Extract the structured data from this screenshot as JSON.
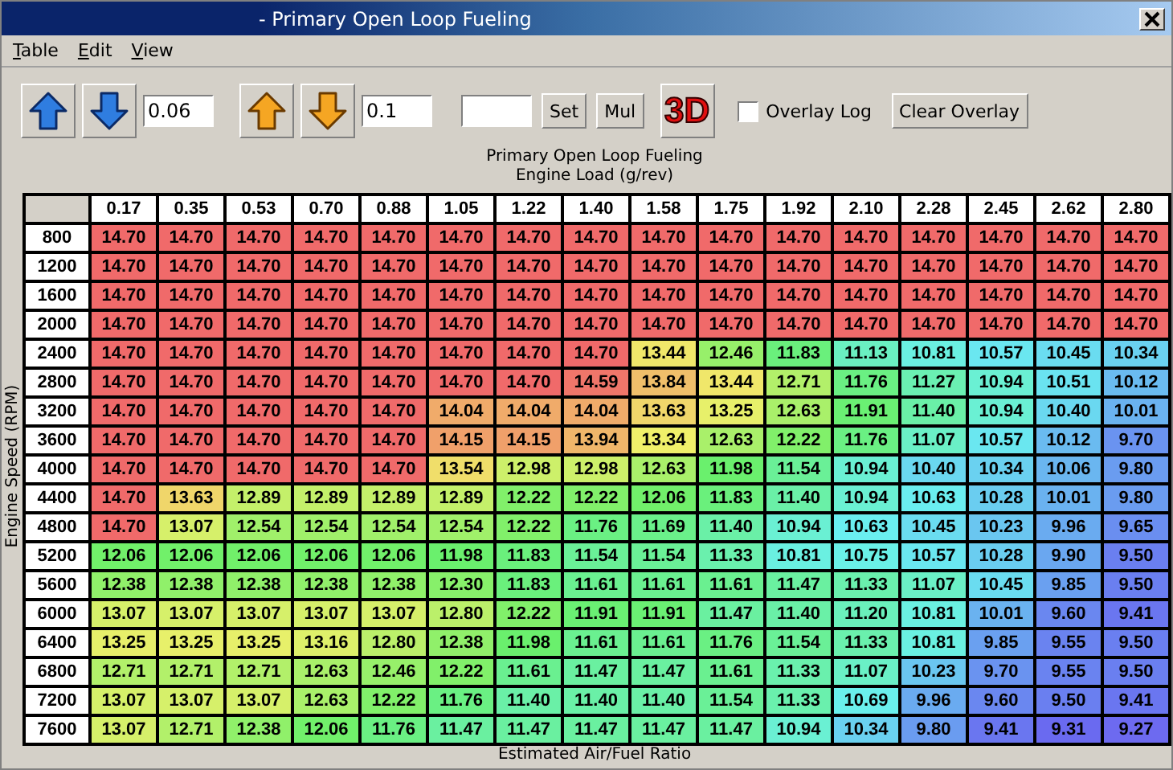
{
  "window": {
    "title": "- Primary Open Loop Fueling"
  },
  "menu": [
    "Table",
    "Edit",
    "View"
  ],
  "toolbar": [
    {
      "kind": "up-small"
    },
    {
      "kind": "down-small"
    },
    {
      "kind": "input",
      "value": "0.06"
    },
    {
      "kind": "up-large"
    },
    {
      "kind": "down-large"
    },
    {
      "kind": "input",
      "value": "0.1"
    },
    {
      "kind": "input"
    },
    {
      "kind": "button",
      "label": "Set"
    },
    {
      "kind": "button",
      "label": "Mul"
    },
    {
      "kind": "logo",
      "label": "3D"
    },
    {
      "kind": "checkbox",
      "label": "Overlay Log",
      "checked": false
    },
    {
      "kind": "button",
      "label": "Clear Overlay"
    }
  ],
  "table": {
    "title": "Primary Open Loop Fueling",
    "x_label": "Engine Load (g/rev)",
    "y_label": "Engine Speed (RPM)",
    "columns": [
      "0.17",
      "0.35",
      "0.53",
      "0.70",
      "0.88",
      "1.05",
      "1.22",
      "1.40",
      "1.58",
      "1.75",
      "1.92",
      "2.10",
      "2.28",
      "2.45",
      "2.62",
      "2.80"
    ],
    "rows": [
      {
        "rpm": "800",
        "values": [
          "14.70",
          "14.70",
          "14.70",
          "14.70",
          "14.70",
          "14.70",
          "14.70",
          "14.70",
          "14.70",
          "14.70",
          "14.70",
          "14.70",
          "14.70",
          "14.70",
          "14.70",
          "14.70"
        ]
      },
      {
        "rpm": "1200",
        "values": [
          "14.70",
          "14.70",
          "14.70",
          "14.70",
          "14.70",
          "14.70",
          "14.70",
          "14.70",
          "14.70",
          "14.70",
          "14.70",
          "14.70",
          "14.70",
          "14.70",
          "14.70",
          "14.70"
        ]
      },
      {
        "rpm": "1600",
        "values": [
          "14.70",
          "14.70",
          "14.70",
          "14.70",
          "14.70",
          "14.70",
          "14.70",
          "14.70",
          "14.70",
          "14.70",
          "14.70",
          "14.70",
          "14.70",
          "14.70",
          "14.70",
          "14.70"
        ]
      },
      {
        "rpm": "2000",
        "values": [
          "14.70",
          "14.70",
          "14.70",
          "14.70",
          "14.70",
          "14.70",
          "14.70",
          "14.70",
          "14.70",
          "14.70",
          "14.70",
          "14.70",
          "14.70",
          "14.70",
          "14.70",
          "14.70"
        ]
      },
      {
        "rpm": "2400",
        "values": [
          "14.70",
          "14.70",
          "14.70",
          "14.70",
          "14.70",
          "14.70",
          "14.70",
          "14.70",
          "13.44",
          "12.46",
          "11.83",
          "11.13",
          "10.81",
          "10.57",
          "10.45",
          "10.34"
        ]
      },
      {
        "rpm": "2800",
        "values": [
          "14.70",
          "14.70",
          "14.70",
          "14.70",
          "14.70",
          "14.70",
          "14.70",
          "14.59",
          "13.84",
          "13.44",
          "12.71",
          "11.76",
          "11.27",
          "10.94",
          "10.51",
          "10.12"
        ]
      },
      {
        "rpm": "3200",
        "values": [
          "14.70",
          "14.70",
          "14.70",
          "14.70",
          "14.70",
          "14.04",
          "14.04",
          "14.04",
          "13.63",
          "13.25",
          "12.63",
          "11.91",
          "11.40",
          "10.94",
          "10.40",
          "10.01"
        ]
      },
      {
        "rpm": "3600",
        "values": [
          "14.70",
          "14.70",
          "14.70",
          "14.70",
          "14.70",
          "14.15",
          "14.15",
          "13.94",
          "13.34",
          "12.63",
          "12.22",
          "11.76",
          "11.07",
          "10.57",
          "10.12",
          "9.70"
        ]
      },
      {
        "rpm": "4000",
        "values": [
          "14.70",
          "14.70",
          "14.70",
          "14.70",
          "14.70",
          "13.54",
          "12.98",
          "12.98",
          "12.63",
          "11.98",
          "11.54",
          "10.94",
          "10.40",
          "10.34",
          "10.06",
          "9.80"
        ]
      },
      {
        "rpm": "4400",
        "values": [
          "14.70",
          "13.63",
          "12.89",
          "12.89",
          "12.89",
          "12.89",
          "12.22",
          "12.22",
          "12.06",
          "11.83",
          "11.40",
          "10.94",
          "10.63",
          "10.28",
          "10.01",
          "9.80"
        ]
      },
      {
        "rpm": "4800",
        "values": [
          "14.70",
          "13.07",
          "12.54",
          "12.54",
          "12.54",
          "12.54",
          "12.22",
          "11.76",
          "11.69",
          "11.40",
          "10.94",
          "10.63",
          "10.45",
          "10.23",
          "9.96",
          "9.65"
        ]
      },
      {
        "rpm": "5200",
        "values": [
          "12.06",
          "12.06",
          "12.06",
          "12.06",
          "12.06",
          "11.98",
          "11.83",
          "11.54",
          "11.54",
          "11.33",
          "10.81",
          "10.75",
          "10.57",
          "10.28",
          "9.90",
          "9.50"
        ]
      },
      {
        "rpm": "5600",
        "values": [
          "12.38",
          "12.38",
          "12.38",
          "12.38",
          "12.38",
          "12.30",
          "11.83",
          "11.61",
          "11.61",
          "11.61",
          "11.47",
          "11.33",
          "11.07",
          "10.45",
          "9.85",
          "9.50"
        ]
      },
      {
        "rpm": "6000",
        "values": [
          "13.07",
          "13.07",
          "13.07",
          "13.07",
          "13.07",
          "12.80",
          "12.22",
          "11.91",
          "11.91",
          "11.47",
          "11.40",
          "11.20",
          "10.81",
          "10.01",
          "9.60",
          "9.41"
        ]
      },
      {
        "rpm": "6400",
        "values": [
          "13.25",
          "13.25",
          "13.25",
          "13.16",
          "12.80",
          "12.38",
          "11.98",
          "11.61",
          "11.61",
          "11.76",
          "11.54",
          "11.33",
          "10.81",
          "9.85",
          "9.55",
          "9.50"
        ]
      },
      {
        "rpm": "6800",
        "values": [
          "12.71",
          "12.71",
          "12.71",
          "12.63",
          "12.46",
          "12.22",
          "11.61",
          "11.47",
          "11.47",
          "11.61",
          "11.33",
          "11.07",
          "10.23",
          "9.70",
          "9.55",
          "9.50"
        ]
      },
      {
        "rpm": "7200",
        "values": [
          "13.07",
          "13.07",
          "13.07",
          "12.63",
          "12.22",
          "11.76",
          "11.40",
          "11.40",
          "11.40",
          "11.54",
          "11.33",
          "10.69",
          "9.96",
          "9.60",
          "9.50",
          "9.41"
        ]
      },
      {
        "rpm": "7600",
        "values": [
          "13.07",
          "12.71",
          "12.38",
          "12.06",
          "11.76",
          "11.47",
          "11.47",
          "11.47",
          "11.47",
          "11.47",
          "10.94",
          "10.34",
          "9.80",
          "9.41",
          "9.31",
          "9.27"
        ]
      }
    ],
    "footer": "Estimated Air/Fuel Ratio"
  }
}
